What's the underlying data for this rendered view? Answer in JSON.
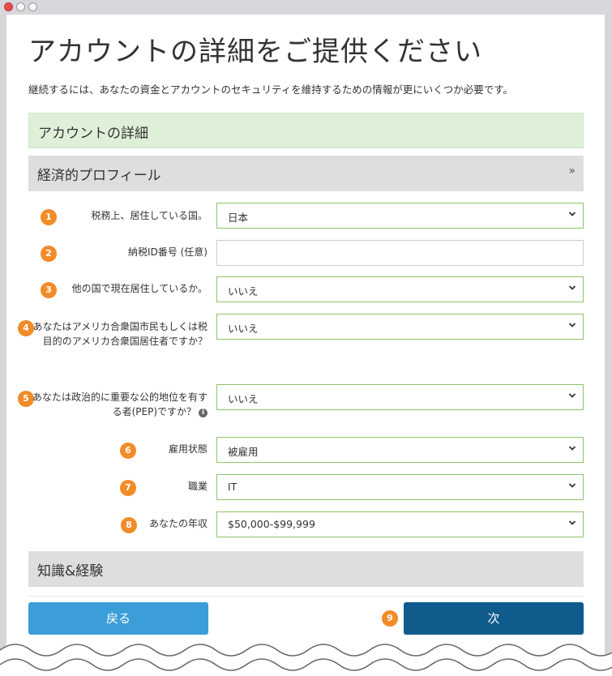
{
  "page": {
    "title": "アカウントの詳細をご提供ください",
    "subtitle": "継続するには、あなたの資金とアカウントのセキュリティを維持するための情報が更にいくつか必要です。"
  },
  "sections": {
    "account_details": "アカウントの詳細",
    "financial_profile": "経済的プロフィール",
    "knowledge_experience": "知識&経験"
  },
  "fields": [
    {
      "number": "1",
      "label": "税務上、居住している国。",
      "value": "日本"
    },
    {
      "number": "2",
      "label": "納税ID番号 (任意)",
      "value": ""
    },
    {
      "number": "3",
      "label": "他の国で現在居住しているか。",
      "value": "いいえ"
    },
    {
      "number": "4",
      "label": "あなたはアメリカ合衆国市民もしくは税目的のアメリカ合衆国居住者ですか？",
      "value": "いいえ"
    },
    {
      "number": "5",
      "label": "あなたは政治的に重要な公的地位を有する者(PEP)ですか？",
      "value": "いいえ"
    },
    {
      "number": "6",
      "label": "雇用状態",
      "value": "被雇用"
    },
    {
      "number": "7",
      "label": "職業",
      "value": "IT"
    },
    {
      "number": "8",
      "label": "あなたの年収",
      "value": "$50,000-$99,999"
    }
  ],
  "buttons": {
    "back": "戻る",
    "next": "次",
    "next_number": "9"
  },
  "icons": {
    "section_toggle": "double-chevron-down-icon",
    "info": "info-icon",
    "select_arrow": "chevron-down-icon"
  },
  "colors": {
    "accent_badge": "#f28c28",
    "select_border": "#8cc56a",
    "back_button": "#3b9ed8",
    "next_button": "#0e5b8c",
    "section_green": "#dff0d8"
  }
}
